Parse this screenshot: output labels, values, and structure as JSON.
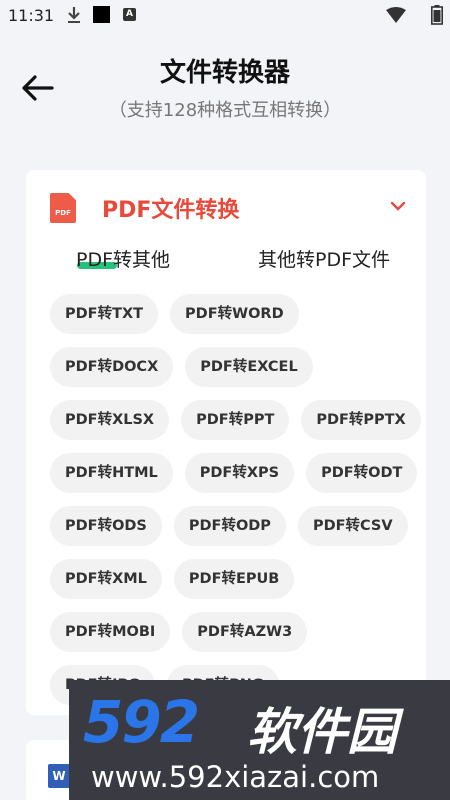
{
  "status_bar": {
    "time": "11:31",
    "badge_letter": "A"
  },
  "header": {
    "title": "文件转换器",
    "subtitle": "（支持128种格式互相转换）"
  },
  "card": {
    "icon_text": "PDF",
    "title": "PDF文件转换",
    "tabs": [
      {
        "label": "PDF转其他",
        "active": true
      },
      {
        "label": "其他转PDF文件",
        "active": false
      }
    ],
    "chips": [
      [
        "PDF转TXT",
        "PDF转WORD"
      ],
      [
        "PDF转DOCX",
        "PDF转EXCEL"
      ],
      [
        "PDF转XLSX",
        "PDF转PPT",
        "PDF转PPTX"
      ],
      [
        "PDF转HTML",
        "PDF转XPS",
        "PDF转ODT"
      ],
      [
        "PDF转ODS",
        "PDF转ODP",
        "PDF转CSV"
      ],
      [
        "PDF转XML",
        "PDF转EPUB"
      ],
      [
        "PDF转MOBI",
        "PDF转AZW3"
      ],
      [
        "PDF转JPG",
        "PDF转PNG"
      ]
    ]
  },
  "card2": {
    "icon_text": "W"
  },
  "watermark": {
    "logo": "592",
    "brand": "软件园",
    "url": "www.592xiazai.com"
  },
  "colors": {
    "accent_red": "#e8493b",
    "tab_indicator": "#27c17e",
    "chip_bg": "#f2f2f2"
  },
  "icons": [
    "download-icon",
    "wifi-icon",
    "battery-icon",
    "back-arrow-icon",
    "pdf-file-icon",
    "chevron-down-icon",
    "word-file-icon"
  ]
}
